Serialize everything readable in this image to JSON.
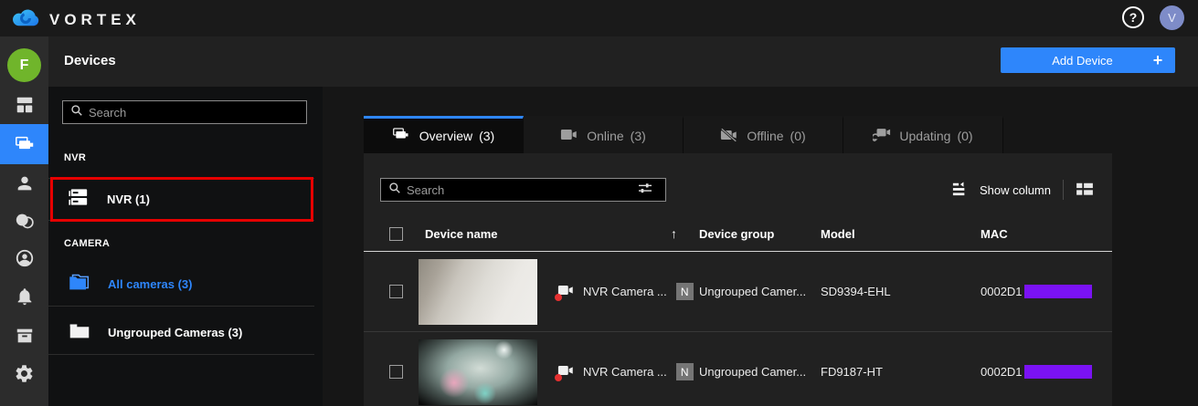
{
  "topbar": {
    "brand": "VORTEX",
    "help_label": "?",
    "avatar_initial": "V"
  },
  "rail": {
    "avatar_initial": "F",
    "items": [
      {
        "icon": "dashboard-icon",
        "active": false
      },
      {
        "icon": "devices-icon",
        "active": true
      },
      {
        "icon": "users-icon",
        "active": false
      },
      {
        "icon": "roles-icon",
        "active": false
      },
      {
        "icon": "account-icon",
        "active": false
      },
      {
        "icon": "notifications-icon",
        "active": false
      },
      {
        "icon": "archive-icon",
        "active": false
      },
      {
        "icon": "settings-icon",
        "active": false
      }
    ]
  },
  "header": {
    "title": "Devices",
    "add_device_label": "Add Device",
    "add_device_plus": "+"
  },
  "sidebar": {
    "search_placeholder": "Search",
    "nvr_section_label": "NVR",
    "nvr_item_label": "NVR (1)",
    "camera_section_label": "CAMERA",
    "all_cameras_label": "All cameras (3)",
    "ungrouped_label": "Ungrouped Cameras (3)"
  },
  "tabs": [
    {
      "label": "Overview",
      "count": "(3)",
      "active": true
    },
    {
      "label": "Online",
      "count": "(3)",
      "active": false
    },
    {
      "label": "Offline",
      "count": "(0)",
      "active": false
    },
    {
      "label": "Updating",
      "count": "(0)",
      "active": false
    }
  ],
  "toolbar": {
    "search_placeholder": "Search",
    "show_column_label": "Show column"
  },
  "table": {
    "columns": {
      "device_name": "Device name",
      "device_group": "Device group",
      "model": "Model",
      "mac": "MAC"
    },
    "sort_indicator": "↑",
    "rows": [
      {
        "name": "NVR Camera ...",
        "new_badge": "N",
        "group": "Ungrouped Camer...",
        "model": "SD9394-EHL",
        "mac_prefix": "0002D1"
      },
      {
        "name": "NVR Camera ...",
        "new_badge": "N",
        "group": "Ungrouped Camer...",
        "model": "FD9187-HT",
        "mac_prefix": "0002D1"
      }
    ]
  },
  "colors": {
    "accent_blue": "#2e86fb",
    "annotation_red": "#e60000",
    "redaction_purple": "#7a12f4",
    "avatar_green": "#70b52b",
    "avatar_blue": "#7e8cc8",
    "badge_grey": "#757575"
  }
}
